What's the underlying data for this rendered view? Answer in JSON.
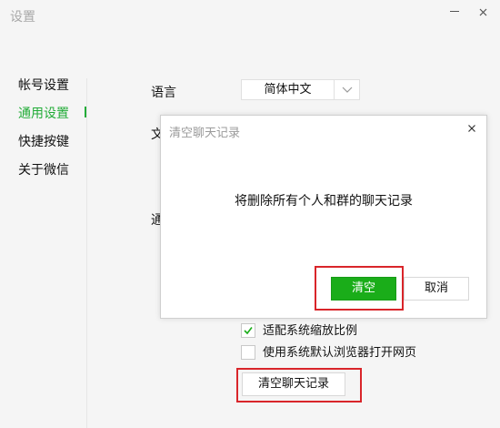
{
  "window": {
    "title": "设置"
  },
  "sidebar": {
    "items": [
      {
        "label": "帐号设置"
      },
      {
        "label": "通用设置"
      },
      {
        "label": "快捷按键"
      },
      {
        "label": "关于微信"
      }
    ],
    "active_index": 1,
    "active_color": "#22ac38"
  },
  "general": {
    "language_label": "语言",
    "language_value": "简体中文",
    "partial_label_1": "文",
    "partial_label_2": "通",
    "options": [
      {
        "label": "适配系统缩放比例",
        "checked": true
      },
      {
        "label": "使用系统默认浏览器打开网页",
        "checked": false
      }
    ],
    "clear_history_button": "清空聊天记录"
  },
  "dialog": {
    "title": "清空聊天记录",
    "message": "将删除所有个人和群的聊天记录",
    "confirm_label": "清空",
    "cancel_label": "取消",
    "confirm_color": "#1aad19"
  },
  "annotation_color": "#d9252a"
}
